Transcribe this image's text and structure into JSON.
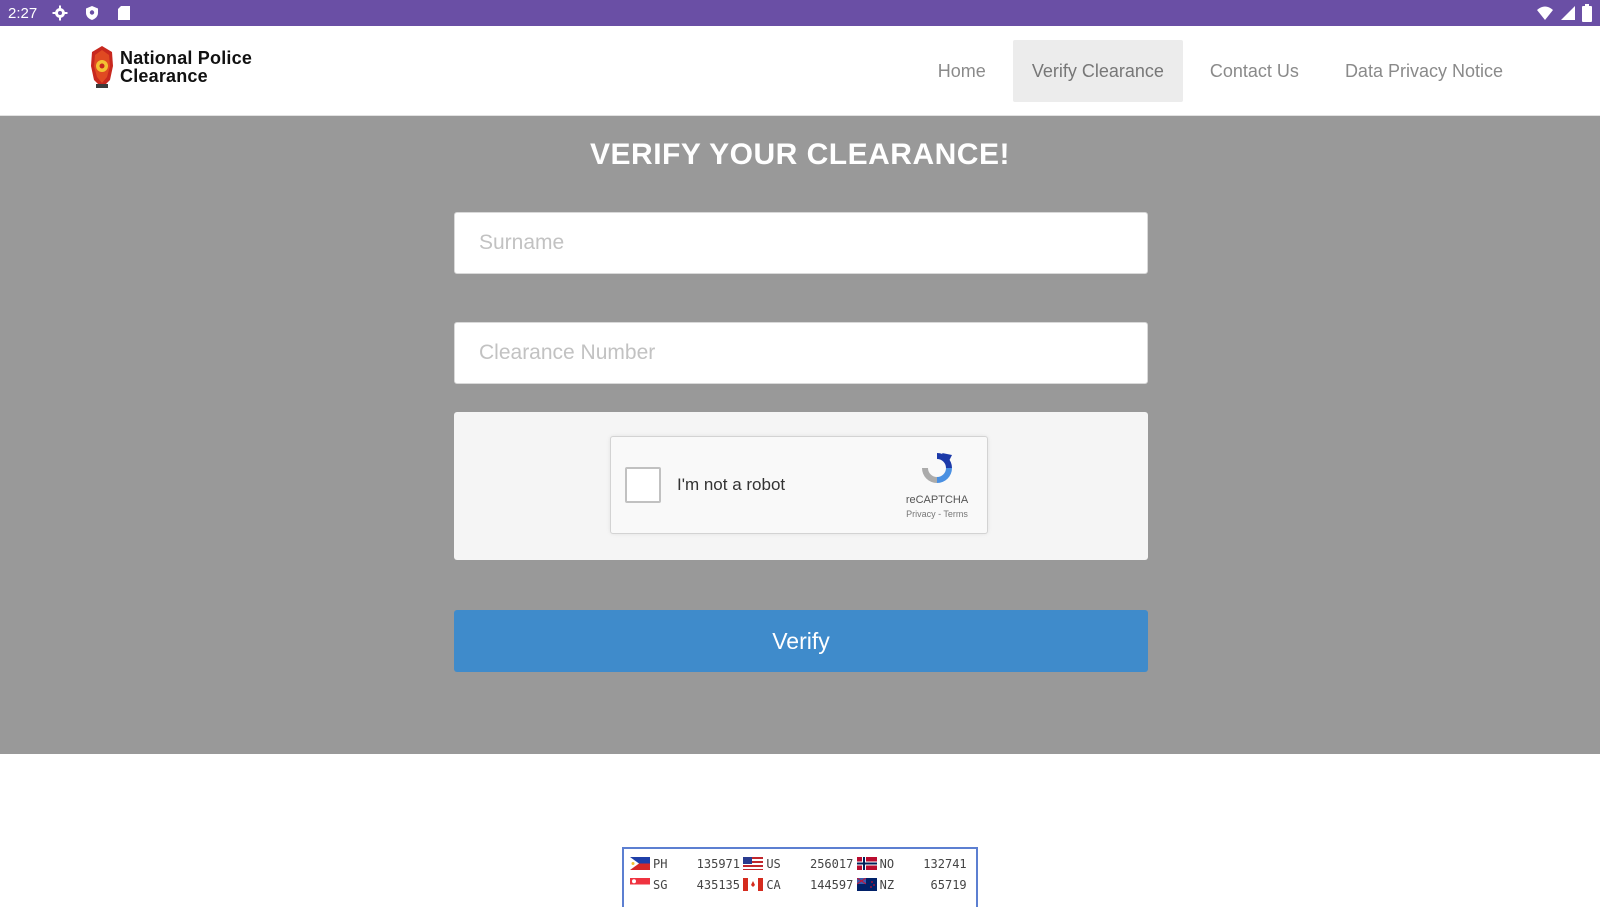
{
  "status_bar": {
    "time": "2:27",
    "icons": [
      "gear-icon",
      "shield-icon",
      "sd-card-icon"
    ],
    "right_icons": [
      "wifi-icon",
      "signal-icon",
      "battery-icon"
    ]
  },
  "header": {
    "logo_line1": "National Police",
    "logo_line2": "Clearance",
    "nav": [
      {
        "label": "Home",
        "active": false
      },
      {
        "label": "Verify Clearance",
        "active": true
      },
      {
        "label": "Contact Us",
        "active": false
      },
      {
        "label": "Data Privacy Notice",
        "active": false
      }
    ]
  },
  "main": {
    "title": "VERIFY YOUR CLEARANCE!",
    "surname_placeholder": "Surname",
    "surname_value": "",
    "clearance_placeholder": "Clearance Number",
    "clearance_value": "",
    "captcha": {
      "label": "I'm not a robot",
      "brand": "reCAPTCHA",
      "links": "Privacy - Terms"
    },
    "verify_label": "Verify",
    "colors": {
      "band": "#999999",
      "button": "#3f8bcb",
      "status_bar": "#6a4fa5"
    }
  },
  "flag_counter": {
    "rows": [
      [
        {
          "code": "PH",
          "count": "135971"
        },
        {
          "code": "US",
          "count": "256017"
        },
        {
          "code": "NO",
          "count": "132741"
        }
      ],
      [
        {
          "code": "SG",
          "count": "435135"
        },
        {
          "code": "CA",
          "count": "144597"
        },
        {
          "code": "NZ",
          "count": "65719"
        }
      ]
    ]
  }
}
